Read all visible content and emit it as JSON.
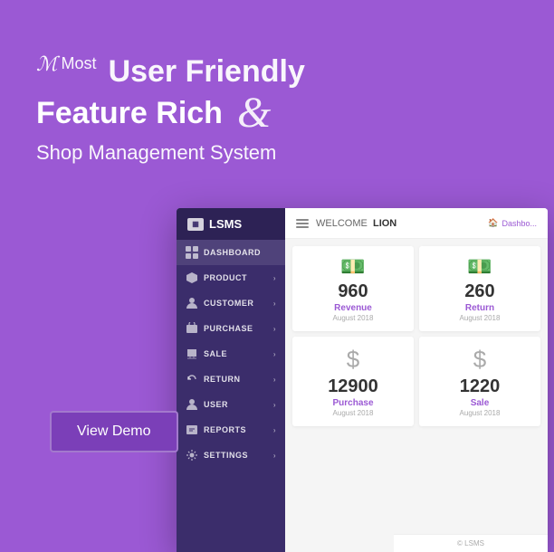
{
  "hero": {
    "most_label": "Most",
    "title_line1": "User Friendly",
    "title_line2": "Feature Rich",
    "ampersand": "&",
    "subtitle": "Shop Management System",
    "script_m": "ℳ"
  },
  "cta": {
    "button_label": "View Demo"
  },
  "sidebar": {
    "logo_text": "LSMS",
    "items": [
      {
        "label": "DASHBOARD",
        "has_chevron": false
      },
      {
        "label": "PRODUCT",
        "has_chevron": true
      },
      {
        "label": "CUSTOMER",
        "has_chevron": true
      },
      {
        "label": "PURCHASE",
        "has_chevron": true
      },
      {
        "label": "SALE",
        "has_chevron": true
      },
      {
        "label": "RETURN",
        "has_chevron": true
      },
      {
        "label": "USER",
        "has_chevron": true
      },
      {
        "label": "REPORTS",
        "has_chevron": true
      },
      {
        "label": "SETTINGS",
        "has_chevron": true
      }
    ]
  },
  "topbar": {
    "welcome_prefix": "WELCOME",
    "welcome_name": "LION",
    "dashboard_link": "Dashbo..."
  },
  "stats": [
    {
      "icon": "💵",
      "number": "960",
      "label": "Revenue",
      "date": "August 2018"
    },
    {
      "icon": "💵",
      "number": "260",
      "label": "Return",
      "date": "August 2018"
    },
    {
      "icon": "$",
      "number": "12900",
      "label": "Purchase",
      "date": "August 2018"
    },
    {
      "icon": "$",
      "number": "1220",
      "label": "Sale",
      "date": "August 2018"
    }
  ],
  "footer": {
    "copyright": "© LSMS"
  }
}
